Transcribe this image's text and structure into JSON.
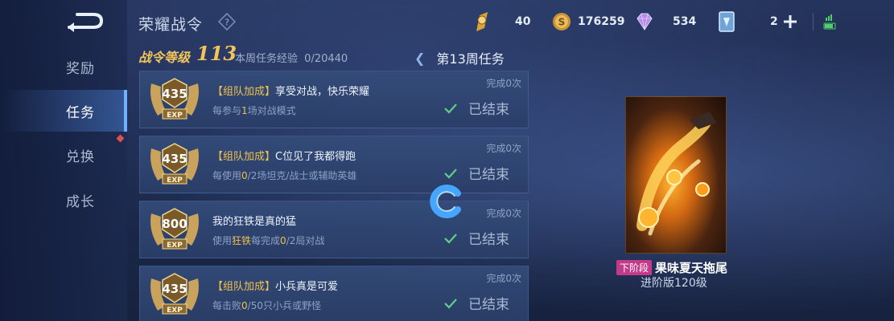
{
  "sidebar": {
    "items": [
      {
        "label": "奖励"
      },
      {
        "label": "任务"
      },
      {
        "label": "兑换"
      },
      {
        "label": "成长"
      }
    ]
  },
  "header": {
    "title": "荣耀战令",
    "level_label": "战令等级",
    "level_value": "113",
    "xp_label": "本周任务经验",
    "xp_current": "0",
    "xp_total": "/20440",
    "week_label": "第13周任务"
  },
  "currencies": [
    {
      "icon": "star-coin-icon",
      "value": "40"
    },
    {
      "icon": "gold-coin-icon",
      "value": "176259"
    },
    {
      "icon": "diamond-icon",
      "value": "534"
    },
    {
      "icon": "card-icon",
      "value": "2"
    }
  ],
  "tasks": [
    {
      "exp": "435",
      "exp_unit": "EXP",
      "tag": "【组队加成】",
      "title": "享受对战，快乐荣耀",
      "desc_pre": "每参与",
      "desc_hl": "1",
      "desc_mid": "场对战模式",
      "desc_hl2": "",
      "desc_post": "",
      "count": "完成0次",
      "status": "已结束"
    },
    {
      "exp": "435",
      "exp_unit": "EXP",
      "tag": "【组队加成】",
      "title": "C位见了我都得跑",
      "desc_pre": "每使用",
      "desc_hl": "0",
      "desc_mid": "/2场坦克/战士或辅助英雄",
      "desc_hl2": "",
      "desc_post": "",
      "count": "完成0次",
      "status": "已结束"
    },
    {
      "exp": "800",
      "exp_unit": "EXP",
      "tag": "",
      "title": "我的狂铁是真的猛",
      "desc_pre": "使用",
      "desc_hl": "狂铁",
      "desc_mid": "每完成",
      "desc_hl2": "0",
      "desc_post": "/2局对战",
      "count": "完成0次",
      "status": "已结束"
    },
    {
      "exp": "435",
      "exp_unit": "EXP",
      "tag": "【组队加成】",
      "title": "小兵真是可爱",
      "desc_pre": "每击败",
      "desc_hl": "0",
      "desc_mid": "/50只小兵或野怪",
      "desc_hl2": "",
      "desc_post": "",
      "count": "完成0次",
      "status": "已结束"
    }
  ],
  "reward": {
    "stage_tag": "下阶段",
    "name": "果味夏天拖尾",
    "sub": "进阶版120级"
  },
  "colors": {
    "accent_gold": "#f0c14e",
    "active_nav": "#6fb0ff"
  }
}
